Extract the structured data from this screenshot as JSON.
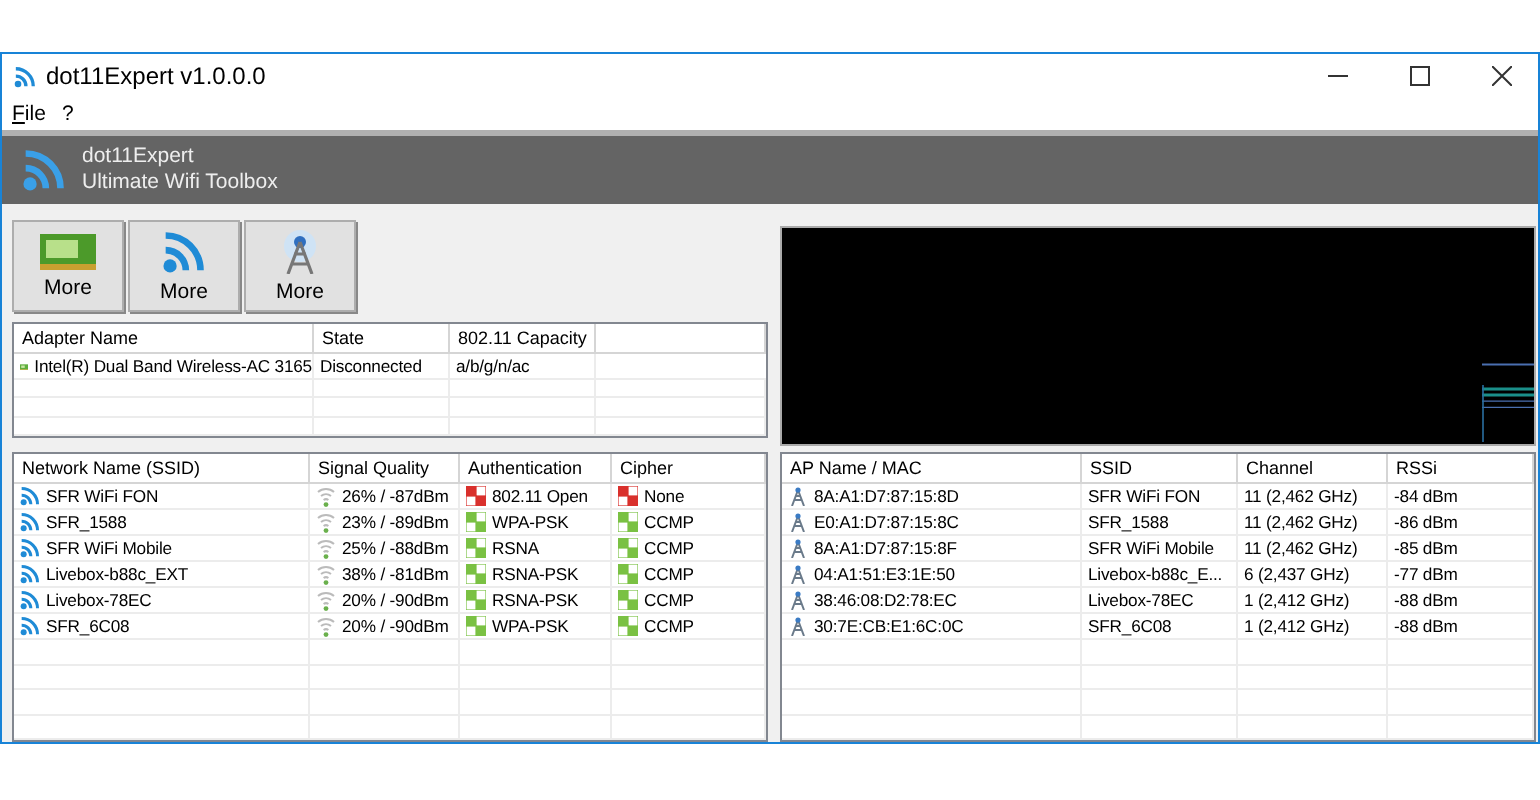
{
  "window": {
    "title": "dot11Expert v1.0.0.0"
  },
  "menu": [
    {
      "label": "File"
    },
    {
      "label": "?"
    }
  ],
  "header": {
    "title": "dot11Expert",
    "subtitle": "Ultimate Wifi Toolbox"
  },
  "tool_buttons": [
    {
      "kind": "adapter",
      "label": "More"
    },
    {
      "kind": "wifi",
      "label": "More"
    },
    {
      "kind": "tower",
      "label": "More"
    }
  ],
  "adapters": {
    "columns": [
      "Adapter Name",
      "State",
      "802.11 Capacity"
    ],
    "rows": [
      {
        "name": "Intel(R) Dual Band Wireless-AC 3165",
        "state": "Disconnected",
        "capacity": "a/b/g/n/ac"
      }
    ]
  },
  "networks": {
    "columns": [
      "Network Name (SSID)",
      "Signal Quality",
      "Authentication",
      "Cipher"
    ],
    "rows": [
      {
        "ssid": "SFR WiFi FON",
        "signal": "26% / -87dBm",
        "auth": "802.11 Open",
        "auth_secure": false,
        "cipher": "None",
        "cipher_secure": false
      },
      {
        "ssid": "SFR_1588",
        "signal": "23% / -89dBm",
        "auth": "WPA-PSK",
        "auth_secure": true,
        "cipher": "CCMP",
        "cipher_secure": true
      },
      {
        "ssid": "SFR WiFi Mobile",
        "signal": "25% / -88dBm",
        "auth": "RSNA",
        "auth_secure": true,
        "cipher": "CCMP",
        "cipher_secure": true
      },
      {
        "ssid": "Livebox-b88c_EXT",
        "signal": "38% / -81dBm",
        "auth": "RSNA-PSK",
        "auth_secure": true,
        "cipher": "CCMP",
        "cipher_secure": true
      },
      {
        "ssid": "Livebox-78EC",
        "signal": "20% / -90dBm",
        "auth": "RSNA-PSK",
        "auth_secure": true,
        "cipher": "CCMP",
        "cipher_secure": true
      },
      {
        "ssid": "SFR_6C08",
        "signal": "20% / -90dBm",
        "auth": "WPA-PSK",
        "auth_secure": true,
        "cipher": "CCMP",
        "cipher_secure": true
      }
    ]
  },
  "access_points": {
    "columns": [
      "AP Name / MAC",
      "SSID",
      "Channel",
      "RSSi"
    ],
    "rows": [
      {
        "mac": "8A:A1:D7:87:15:8D",
        "ssid": "SFR WiFi FON",
        "channel": "11 (2,462 GHz)",
        "rssi": "-84 dBm"
      },
      {
        "mac": "E0:A1:D7:87:15:8C",
        "ssid": "SFR_1588",
        "channel": "11 (2,462 GHz)",
        "rssi": "-86 dBm"
      },
      {
        "mac": "8A:A1:D7:87:15:8F",
        "ssid": "SFR WiFi Mobile",
        "channel": "11 (2,462 GHz)",
        "rssi": "-85 dBm"
      },
      {
        "mac": "04:A1:51:E3:1E:50",
        "ssid": "Livebox-b88c_E...",
        "channel": "6 (2,437 GHz)",
        "rssi": "-77 dBm"
      },
      {
        "mac": "38:46:08:D2:78:EC",
        "ssid": "Livebox-78EC",
        "channel": "1 (2,412 GHz)",
        "rssi": "-88 dBm"
      },
      {
        "mac": "30:7E:CB:E1:6C:0C",
        "ssid": "SFR_6C08",
        "channel": "1 (2,412 GHz)",
        "rssi": "-88 dBm"
      }
    ]
  }
}
